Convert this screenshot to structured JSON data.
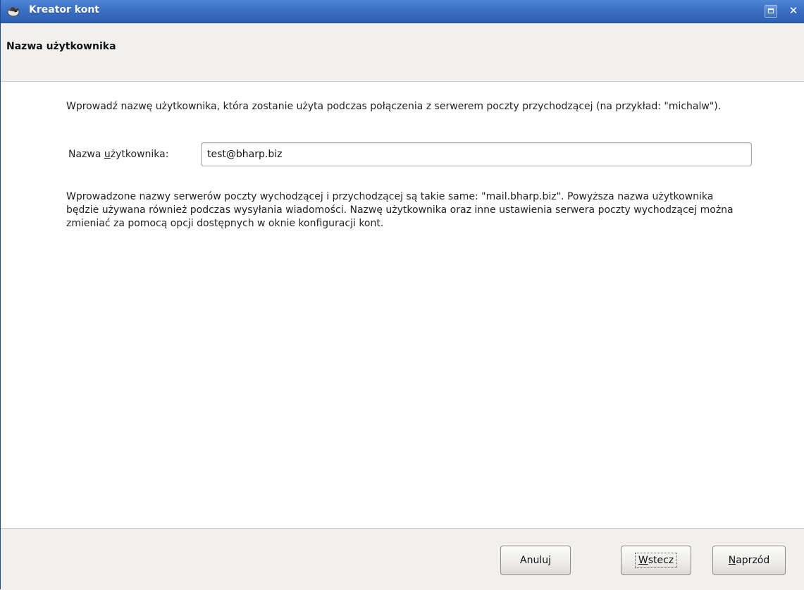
{
  "window": {
    "title": "Kreator kont"
  },
  "header": {
    "title": "Nazwa użytkownika"
  },
  "main": {
    "intro_text": "Wprowadź nazwę użytkownika, która zostanie użyta podczas połączenia z serwerem poczty przychodzącej (na przykład: \"michalw\").",
    "username_label_pre": "Nazwa ",
    "username_label_mnemonic": "u",
    "username_label_post": "żytkownika:",
    "username_value": "test@bharp.biz",
    "info_text": "Wprowadzone nazwy serwerów poczty wychodzącej i przychodzącej są takie same: \"mail.bharp.biz\". Powyższa nazwa użytkownika będzie używana również podczas wysyłania wiadomości. Nazwę użytkownika oraz inne ustawienia serwera poczty wychodzącej można zmieniać za pomocą opcji dostępnych w oknie konfiguracji kont."
  },
  "footer": {
    "cancel_label": "Anuluj",
    "back_mnemonic": "W",
    "back_rest": "stecz",
    "next_mnemonic": "N",
    "next_rest": "aprzód"
  },
  "colors": {
    "titlebar": "#3a6fc4",
    "panel_bg": "#f1f0ef"
  },
  "icons": {
    "app": "thunderbird-bird-icon",
    "maximize": "maximize-icon",
    "close": "close-icon"
  }
}
